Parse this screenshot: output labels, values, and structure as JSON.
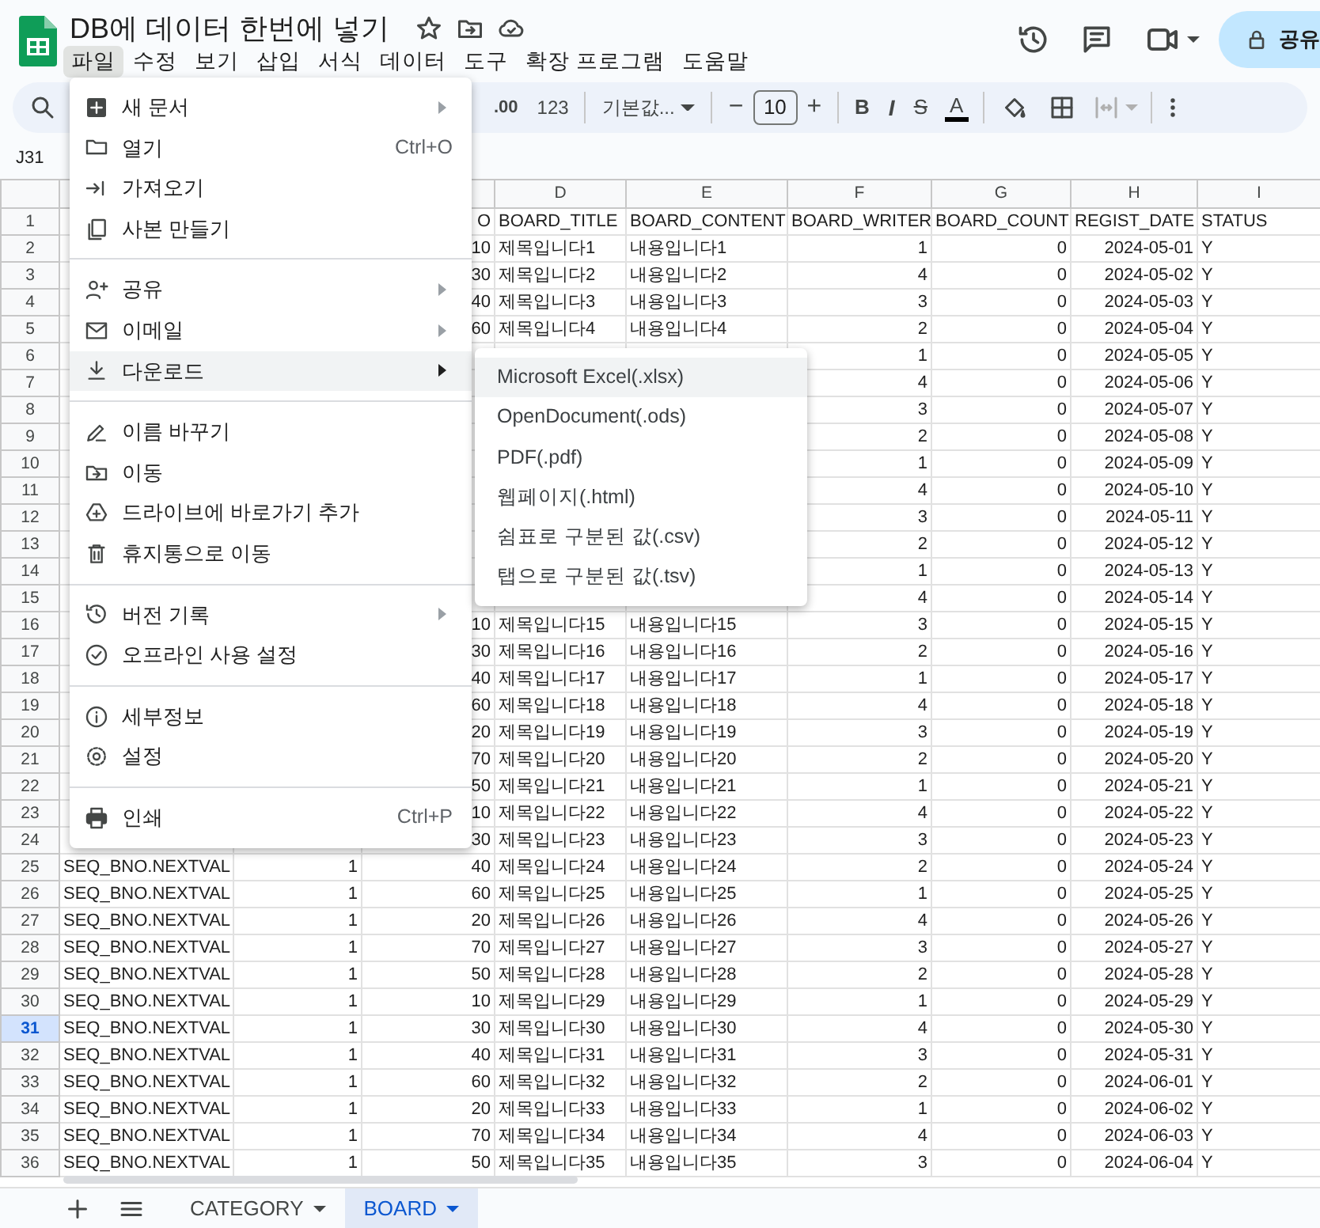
{
  "document": {
    "title": "DB에 데이터 한번에 넣기"
  },
  "menubar": [
    {
      "label": "파일",
      "selected": true
    },
    {
      "label": "수정",
      "selected": false
    },
    {
      "label": "보기",
      "selected": false
    },
    {
      "label": "삽입",
      "selected": false
    },
    {
      "label": "서식",
      "selected": false
    },
    {
      "label": "데이터",
      "selected": false
    },
    {
      "label": "도구",
      "selected": false
    },
    {
      "label": "확장 프로그램",
      "selected": false
    },
    {
      "label": "도움말",
      "selected": false
    }
  ],
  "share_button": {
    "label": "공유"
  },
  "toolbar": {
    "decimal": ".00",
    "number_format": "123",
    "font": "기본값...",
    "size_minus": "−",
    "font_size": "10",
    "size_plus": "+",
    "bold": "B",
    "italic": "I",
    "strike": "S",
    "text_color": "A"
  },
  "name_box": "J31",
  "grid": {
    "column_letters": [
      "D",
      "E",
      "F",
      "G",
      "H",
      "I"
    ],
    "rows": [
      {
        "num": "1",
        "selected": false,
        "cells": [
          null,
          null,
          "O",
          "BOARD_TITLE",
          "BOARD_CONTENT",
          "BOARD_WRITER",
          "BOARD_COUNT",
          "REGIST_DATE",
          "STATUS"
        ]
      },
      {
        "num": "2",
        "selected": false,
        "cells": [
          null,
          null,
          "10",
          "제목입니다1",
          "내용입니다1",
          "1",
          "0",
          "2024-05-01",
          "Y"
        ]
      },
      {
        "num": "3",
        "selected": false,
        "cells": [
          null,
          null,
          "30",
          "제목입니다2",
          "내용입니다2",
          "4",
          "0",
          "2024-05-02",
          "Y"
        ]
      },
      {
        "num": "4",
        "selected": false,
        "cells": [
          null,
          null,
          "40",
          "제목입니다3",
          "내용입니다3",
          "3",
          "0",
          "2024-05-03",
          "Y"
        ]
      },
      {
        "num": "5",
        "selected": false,
        "cells": [
          null,
          null,
          "60",
          "제목입니다4",
          "내용입니다4",
          "2",
          "0",
          "2024-05-04",
          "Y"
        ]
      },
      {
        "num": "6",
        "selected": false,
        "cells": [
          null,
          null,
          null,
          null,
          null,
          "1",
          "0",
          "2024-05-05",
          "Y"
        ]
      },
      {
        "num": "7",
        "selected": false,
        "cells": [
          null,
          null,
          null,
          null,
          null,
          "4",
          "0",
          "2024-05-06",
          "Y"
        ]
      },
      {
        "num": "8",
        "selected": false,
        "cells": [
          null,
          null,
          null,
          null,
          null,
          "3",
          "0",
          "2024-05-07",
          "Y"
        ]
      },
      {
        "num": "9",
        "selected": false,
        "cells": [
          null,
          null,
          null,
          null,
          null,
          "2",
          "0",
          "2024-05-08",
          "Y"
        ]
      },
      {
        "num": "10",
        "selected": false,
        "cells": [
          null,
          null,
          null,
          null,
          null,
          "1",
          "0",
          "2024-05-09",
          "Y"
        ]
      },
      {
        "num": "11",
        "selected": false,
        "cells": [
          null,
          null,
          null,
          null,
          null,
          "4",
          "0",
          "2024-05-10",
          "Y"
        ]
      },
      {
        "num": "12",
        "selected": false,
        "cells": [
          null,
          null,
          null,
          null,
          null,
          "3",
          "0",
          "2024-05-11",
          "Y"
        ]
      },
      {
        "num": "13",
        "selected": false,
        "cells": [
          null,
          null,
          null,
          null,
          null,
          "2",
          "0",
          "2024-05-12",
          "Y"
        ]
      },
      {
        "num": "14",
        "selected": false,
        "cells": [
          null,
          null,
          null,
          null,
          null,
          "1",
          "0",
          "2024-05-13",
          "Y"
        ]
      },
      {
        "num": "15",
        "selected": false,
        "cells": [
          null,
          null,
          null,
          null,
          null,
          "4",
          "0",
          "2024-05-14",
          "Y"
        ]
      },
      {
        "num": "16",
        "selected": false,
        "cells": [
          null,
          null,
          "10",
          "제목입니다15",
          "내용입니다15",
          "3",
          "0",
          "2024-05-15",
          "Y"
        ]
      },
      {
        "num": "17",
        "selected": false,
        "cells": [
          null,
          null,
          "30",
          "제목입니다16",
          "내용입니다16",
          "2",
          "0",
          "2024-05-16",
          "Y"
        ]
      },
      {
        "num": "18",
        "selected": false,
        "cells": [
          null,
          null,
          "40",
          "제목입니다17",
          "내용입니다17",
          "1",
          "0",
          "2024-05-17",
          "Y"
        ]
      },
      {
        "num": "19",
        "selected": false,
        "cells": [
          null,
          null,
          "60",
          "제목입니다18",
          "내용입니다18",
          "4",
          "0",
          "2024-05-18",
          "Y"
        ]
      },
      {
        "num": "20",
        "selected": false,
        "cells": [
          null,
          null,
          "20",
          "제목입니다19",
          "내용입니다19",
          "3",
          "0",
          "2024-05-19",
          "Y"
        ]
      },
      {
        "num": "21",
        "selected": false,
        "cells": [
          null,
          null,
          "70",
          "제목입니다20",
          "내용입니다20",
          "2",
          "0",
          "2024-05-20",
          "Y"
        ]
      },
      {
        "num": "22",
        "selected": false,
        "cells": [
          null,
          null,
          "50",
          "제목입니다21",
          "내용입니다21",
          "1",
          "0",
          "2024-05-21",
          "Y"
        ]
      },
      {
        "num": "23",
        "selected": false,
        "cells": [
          null,
          null,
          "10",
          "제목입니다22",
          "내용입니다22",
          "4",
          "0",
          "2024-05-22",
          "Y"
        ]
      },
      {
        "num": "24",
        "selected": false,
        "cells": [
          null,
          null,
          "30",
          "제목입니다23",
          "내용입니다23",
          "3",
          "0",
          "2024-05-23",
          "Y"
        ]
      },
      {
        "num": "25",
        "selected": false,
        "cells": [
          "SEQ_BNO.NEXTVAL",
          "1",
          "40",
          "제목입니다24",
          "내용입니다24",
          "2",
          "0",
          "2024-05-24",
          "Y"
        ]
      },
      {
        "num": "26",
        "selected": false,
        "cells": [
          "SEQ_BNO.NEXTVAL",
          "1",
          "60",
          "제목입니다25",
          "내용입니다25",
          "1",
          "0",
          "2024-05-25",
          "Y"
        ]
      },
      {
        "num": "27",
        "selected": false,
        "cells": [
          "SEQ_BNO.NEXTVAL",
          "1",
          "20",
          "제목입니다26",
          "내용입니다26",
          "4",
          "0",
          "2024-05-26",
          "Y"
        ]
      },
      {
        "num": "28",
        "selected": false,
        "cells": [
          "SEQ_BNO.NEXTVAL",
          "1",
          "70",
          "제목입니다27",
          "내용입니다27",
          "3",
          "0",
          "2024-05-27",
          "Y"
        ]
      },
      {
        "num": "29",
        "selected": false,
        "cells": [
          "SEQ_BNO.NEXTVAL",
          "1",
          "50",
          "제목입니다28",
          "내용입니다28",
          "2",
          "0",
          "2024-05-28",
          "Y"
        ]
      },
      {
        "num": "30",
        "selected": false,
        "cells": [
          "SEQ_BNO.NEXTVAL",
          "1",
          "10",
          "제목입니다29",
          "내용입니다29",
          "1",
          "0",
          "2024-05-29",
          "Y"
        ]
      },
      {
        "num": "31",
        "selected": true,
        "cells": [
          "SEQ_BNO.NEXTVAL",
          "1",
          "30",
          "제목입니다30",
          "내용입니다30",
          "4",
          "0",
          "2024-05-30",
          "Y"
        ]
      },
      {
        "num": "32",
        "selected": false,
        "cells": [
          "SEQ_BNO.NEXTVAL",
          "1",
          "40",
          "제목입니다31",
          "내용입니다31",
          "3",
          "0",
          "2024-05-31",
          "Y"
        ]
      },
      {
        "num": "33",
        "selected": false,
        "cells": [
          "SEQ_BNO.NEXTVAL",
          "1",
          "60",
          "제목입니다32",
          "내용입니다32",
          "2",
          "0",
          "2024-06-01",
          "Y"
        ]
      },
      {
        "num": "34",
        "selected": false,
        "cells": [
          "SEQ_BNO.NEXTVAL",
          "1",
          "20",
          "제목입니다33",
          "내용입니다33",
          "1",
          "0",
          "2024-06-02",
          "Y"
        ]
      },
      {
        "num": "35",
        "selected": false,
        "cells": [
          "SEQ_BNO.NEXTVAL",
          "1",
          "70",
          "제목입니다34",
          "내용입니다34",
          "4",
          "0",
          "2024-06-03",
          "Y"
        ]
      },
      {
        "num": "36",
        "selected": false,
        "cells": [
          "SEQ_BNO.NEXTVAL",
          "1",
          "50",
          "제목입니다35",
          "내용입니다35",
          "3",
          "0",
          "2024-06-04",
          "Y"
        ]
      }
    ]
  },
  "file_menu": {
    "groups": [
      [
        {
          "label": "새 문서",
          "submenu": true,
          "selected": false
        },
        {
          "label": "열기",
          "shortcut": "Ctrl+O",
          "submenu": false,
          "selected": false
        },
        {
          "label": "가져오기",
          "submenu": false,
          "selected": false
        },
        {
          "label": "사본 만들기",
          "submenu": false,
          "selected": false
        }
      ],
      [
        {
          "label": "공유",
          "submenu": true,
          "selected": false
        },
        {
          "label": "이메일",
          "submenu": true,
          "selected": false
        },
        {
          "label": "다운로드",
          "submenu": true,
          "selected": true
        }
      ],
      [
        {
          "label": "이름 바꾸기",
          "submenu": false,
          "selected": false
        },
        {
          "label": "이동",
          "submenu": false,
          "selected": false
        },
        {
          "label": "드라이브에 바로가기 추가",
          "submenu": false,
          "selected": false
        },
        {
          "label": "휴지통으로 이동",
          "submenu": false,
          "selected": false
        }
      ],
      [
        {
          "label": "버전 기록",
          "submenu": true,
          "selected": false
        },
        {
          "label": "오프라인 사용 설정",
          "submenu": false,
          "selected": false
        }
      ],
      [
        {
          "label": "세부정보",
          "submenu": false,
          "selected": false
        },
        {
          "label": "설정",
          "submenu": false,
          "selected": false
        }
      ],
      [
        {
          "label": "인쇄",
          "shortcut": "Ctrl+P",
          "submenu": false,
          "selected": false
        }
      ]
    ]
  },
  "download_submenu": [
    {
      "label": "Microsoft Excel(.xlsx)",
      "selected": true
    },
    {
      "label": "OpenDocument(.ods)",
      "selected": false
    },
    {
      "label": "PDF(.pdf)",
      "selected": false
    },
    {
      "label": "웹페이지(.html)",
      "selected": false
    },
    {
      "label": "쉼표로 구분된 값(.csv)",
      "selected": false
    },
    {
      "label": "탭으로 구분된 값(.tsv)",
      "selected": false
    }
  ],
  "sheet_tabs": [
    {
      "label": "CATEGORY",
      "selected": false
    },
    {
      "label": "BOARD",
      "selected": true
    }
  ]
}
